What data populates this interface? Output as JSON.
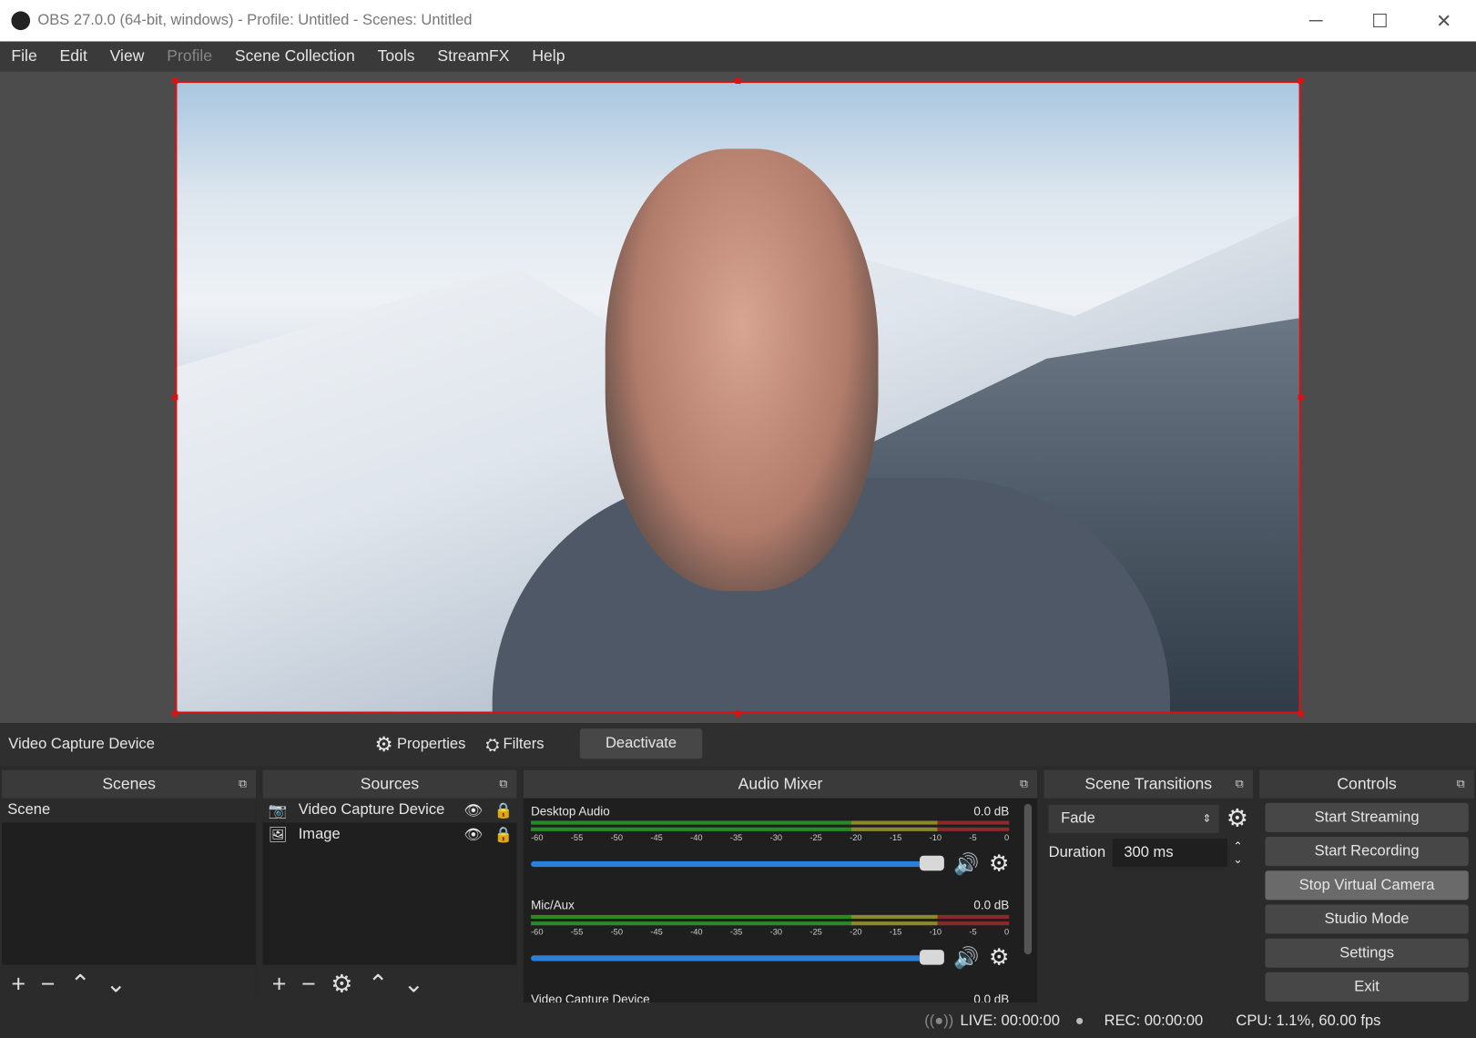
{
  "window": {
    "title": "OBS 27.0.0 (64-bit, windows) - Profile: Untitled - Scenes: Untitled",
    "minimize": "─",
    "maximize": "☐",
    "close": "✕"
  },
  "menu": [
    {
      "label": "File",
      "enabled": true
    },
    {
      "label": "Edit",
      "enabled": true
    },
    {
      "label": "View",
      "enabled": true
    },
    {
      "label": "Profile",
      "enabled": false
    },
    {
      "label": "Scene Collection",
      "enabled": true
    },
    {
      "label": "Tools",
      "enabled": true
    },
    {
      "label": "StreamFX",
      "enabled": true
    },
    {
      "label": "Help",
      "enabled": true
    }
  ],
  "source_toolbar": {
    "selected": "Video Capture Device",
    "properties": "Properties",
    "filters": "Filters",
    "deactivate": "Deactivate"
  },
  "scenes": {
    "title": "Scenes",
    "items": [
      "Scene"
    ]
  },
  "sources": {
    "title": "Sources",
    "items": [
      {
        "name": "Video Capture Device",
        "icon": "camera-icon",
        "visible": true,
        "locked": false
      },
      {
        "name": "Image",
        "icon": "image-icon",
        "visible": true,
        "locked": false
      }
    ]
  },
  "mixer": {
    "title": "Audio Mixer",
    "ticks": [
      "-60",
      "-55",
      "-50",
      "-45",
      "-40",
      "-35",
      "-30",
      "-25",
      "-20",
      "-15",
      "-10",
      "-5",
      "0"
    ],
    "channels": [
      {
        "name": "Desktop Audio",
        "db": "0.0 dB",
        "volume_percent": 100
      },
      {
        "name": "Mic/Aux",
        "db": "0.0 dB",
        "volume_percent": 100
      },
      {
        "name": "Video Capture Device",
        "db": "0.0 dB",
        "volume_percent": 100
      }
    ]
  },
  "transitions": {
    "title": "Scene Transitions",
    "selected": "Fade",
    "duration_label": "Duration",
    "duration": "300 ms"
  },
  "controls": {
    "title": "Controls",
    "buttons": [
      "Start Streaming",
      "Start Recording",
      "Stop Virtual Camera",
      "Studio Mode",
      "Settings",
      "Exit"
    ],
    "active": "Stop Virtual Camera"
  },
  "status": {
    "live": "LIVE: 00:00:00",
    "rec": "REC: 00:00:00",
    "cpu": "CPU: 1.1%, 60.00 fps"
  },
  "colors": {
    "selection": "#e01010",
    "volume": "#2e7fd7"
  }
}
